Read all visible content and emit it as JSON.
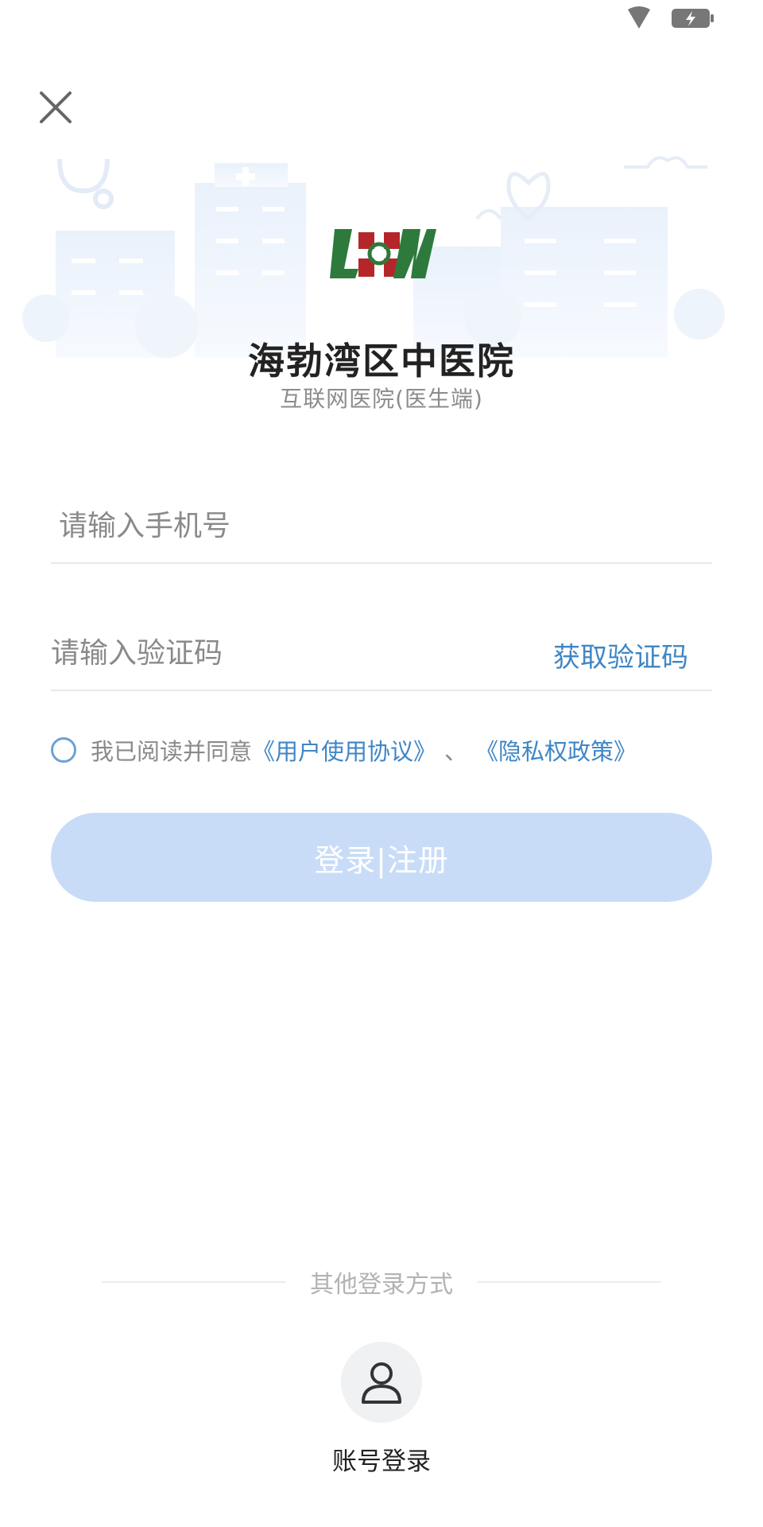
{
  "header": {
    "hospital_name": "海勃湾区中医院",
    "subtitle": "互联网医院(医生端)"
  },
  "form": {
    "phone_placeholder": "请输入手机号",
    "code_placeholder": "请输入验证码",
    "get_code_label": "获取验证码"
  },
  "agreement": {
    "prefix": "我已阅读并同意",
    "user_agreement": "《用户使用协议》",
    "separator": "、",
    "privacy_policy": "《隐私权政策》"
  },
  "login_button": "登录|注册",
  "other_login": {
    "label": "其他登录方式",
    "account_login": "账号登录"
  },
  "icons": [
    "wifi-icon",
    "battery-charging-icon",
    "close-icon",
    "hospital-logo",
    "user-icon"
  ],
  "colors": {
    "accent": "#3f86c5",
    "button_disabled": "#c9dcf7",
    "logo_green": "#2d7a3c",
    "logo_red": "#b5262a"
  }
}
